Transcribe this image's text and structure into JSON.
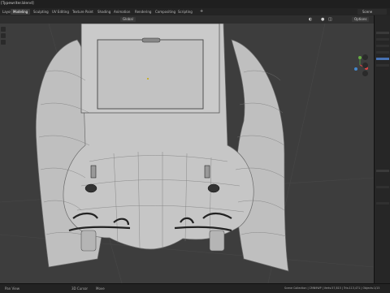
{
  "app": {
    "title": "[Typewriter.blend]",
    "scene_label": "Scene"
  },
  "tabs": [
    {
      "label": "Layout"
    },
    {
      "label": "Modeling"
    },
    {
      "label": "Sculpting"
    },
    {
      "label": "UV Editing"
    },
    {
      "label": "Texture Paint"
    },
    {
      "label": "Shading"
    },
    {
      "label": "Animation"
    },
    {
      "label": "Rendering"
    },
    {
      "label": "Compositing"
    },
    {
      "label": "Scripting"
    }
  ],
  "viewport_header": {
    "transform_orientation": "Global",
    "options_label": "Options"
  },
  "status_bar": {
    "left": [
      "Pan View",
      "3D Cursor",
      "Move"
    ],
    "right": "Scene Collection | CMN9WP | Verts:57,815 | Tris:113,471 | Objects:1/15"
  },
  "colors": {
    "accent": "#4772b3",
    "active_tab": "#3d3d3d"
  }
}
